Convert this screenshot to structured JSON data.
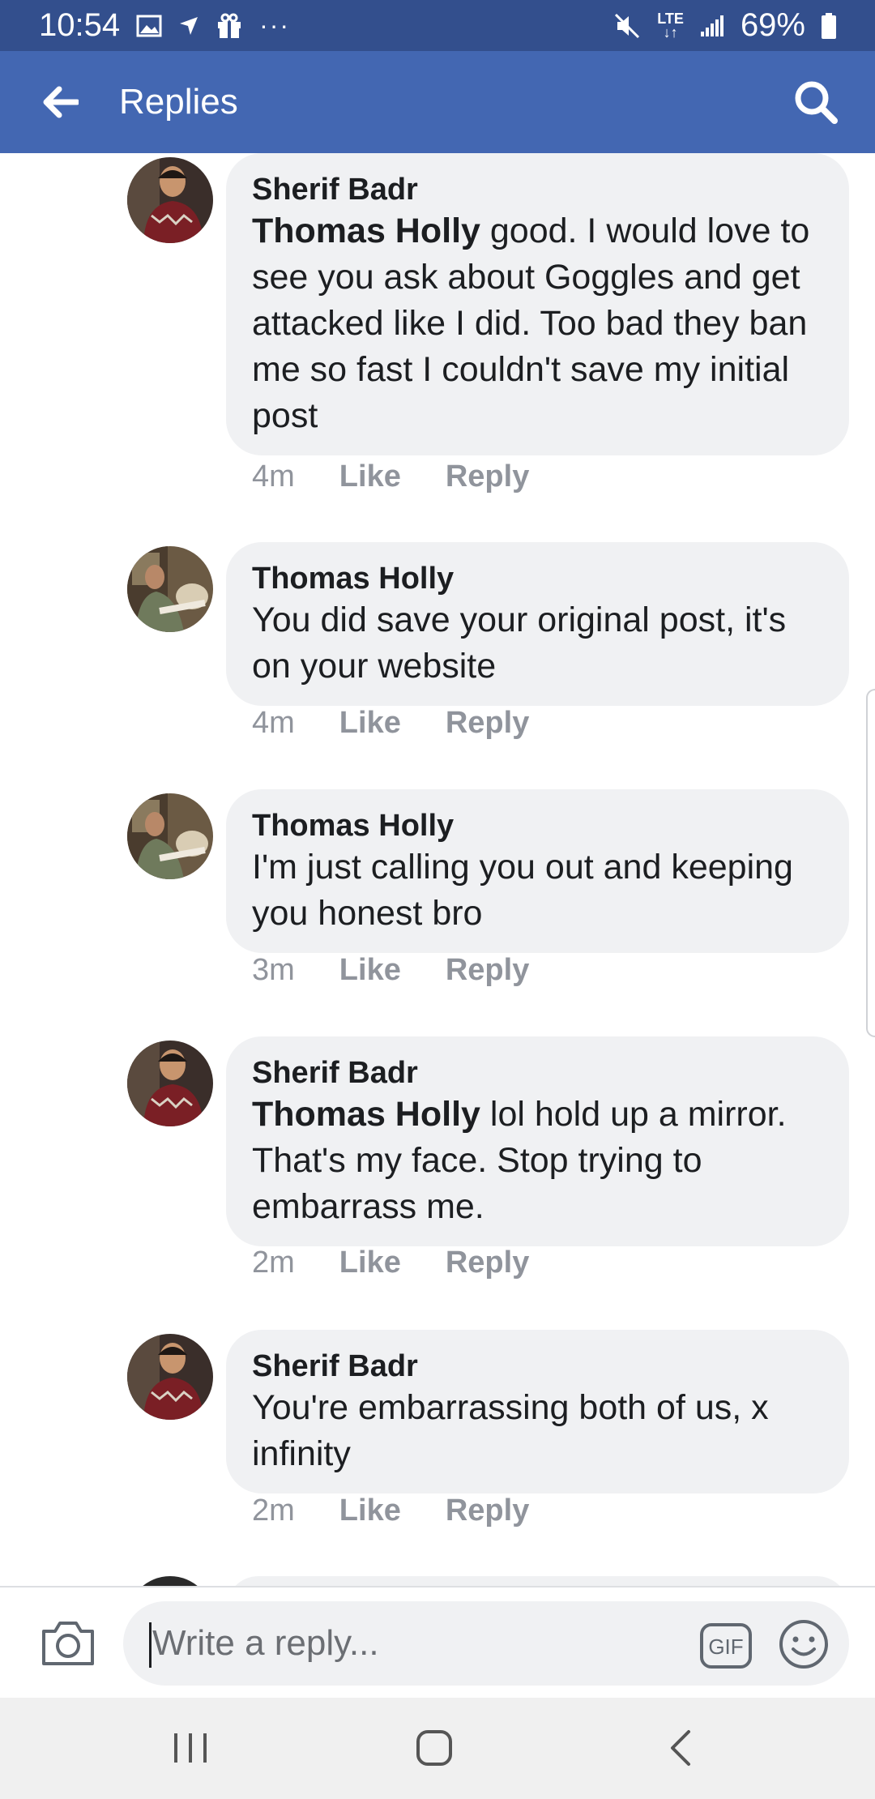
{
  "status_bar": {
    "time": "10:54",
    "lte": "LTE",
    "battery": "69%",
    "dots": "···"
  },
  "header": {
    "title": "Replies",
    "back_icon": "arrow-left-icon",
    "search_icon": "search-icon"
  },
  "comments": [
    {
      "author": "Sherif Badr",
      "mention": "Thomas Holly",
      "text": " good. I would love to see you ask about Goggles and get attacked like I did. Too bad they ban me so fast I couldn't save my initial post",
      "time": "4m",
      "like": "Like",
      "reply": "Reply"
    },
    {
      "author": "Thomas Holly",
      "mention": "",
      "text": "You did save your original post, it's on your website",
      "time": "4m",
      "like": "Like",
      "reply": "Reply"
    },
    {
      "author": "Thomas Holly",
      "mention": "",
      "text": "I'm just calling you out and keeping you honest bro",
      "time": "3m",
      "like": "Like",
      "reply": "Reply"
    },
    {
      "author": "Sherif Badr",
      "mention": "Thomas Holly",
      "text": " lol hold up a mirror. That's my face. Stop trying to embarrass me.",
      "time": "2m",
      "like": "Like",
      "reply": "Reply"
    },
    {
      "author": "Sherif Badr",
      "mention": "",
      "text": "You're embarrassing both of us, x infinity",
      "time": "2m",
      "like": "Like",
      "reply": "Reply"
    }
  ],
  "composer": {
    "placeholder": "Write a reply...",
    "gif_label": "GIF"
  },
  "colors": {
    "status_bar": "#334f8d",
    "header": "#4367b2",
    "bubble": "#f0f1f3",
    "meta_text": "#90949c"
  }
}
